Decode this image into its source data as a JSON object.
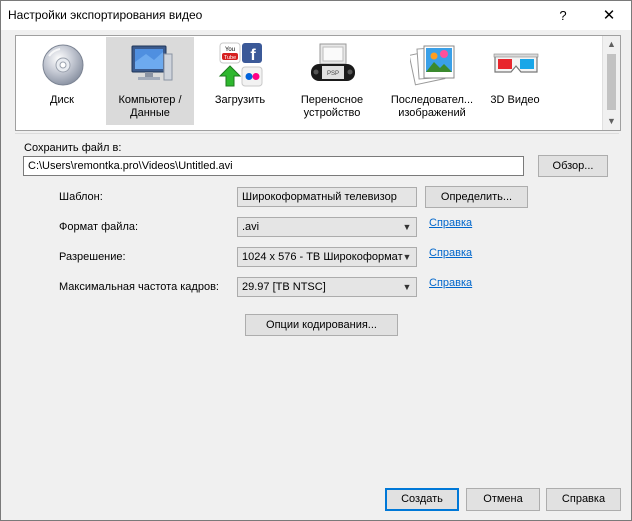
{
  "window": {
    "title": "Настройки экспортирования видео",
    "help_glyph": "?",
    "close_glyph": "✕"
  },
  "categories": [
    {
      "label": "Диск",
      "icon": "disc-icon",
      "selected": false
    },
    {
      "label": "Компьютер / Данные",
      "icon": "computer-icon",
      "selected": true
    },
    {
      "label": "Загрузить",
      "icon": "upload-icon",
      "selected": false
    },
    {
      "label": "Переносное устройство",
      "icon": "psp-icon",
      "selected": false
    },
    {
      "label": "Последовател... изображений",
      "icon": "image-sequence-icon",
      "selected": false
    },
    {
      "label": "3D Видео",
      "icon": "3d-glasses-icon",
      "selected": false
    }
  ],
  "save": {
    "label": "Сохранить файл в:",
    "path": "C:\\Users\\remontka.pro\\Videos\\Untitled.avi",
    "browse": "Обзор..."
  },
  "template": {
    "label": "Шаблон:",
    "value": "Широкоформатный телевизор",
    "define": "Определить..."
  },
  "format": {
    "label": "Формат файла:",
    "value": ".avi",
    "help": "Справка"
  },
  "resolution": {
    "label": "Разрешение:",
    "value": "1024 x 576 - ТВ Широкоформат",
    "help": "Справка"
  },
  "framerate": {
    "label": "Максимальная частота кадров:",
    "value": "29.97 [ТВ NTSC]",
    "help": "Справка"
  },
  "encoding_button": "Опции кодирования...",
  "footer": {
    "create": "Создать",
    "cancel": "Отмена",
    "help": "Справка"
  }
}
